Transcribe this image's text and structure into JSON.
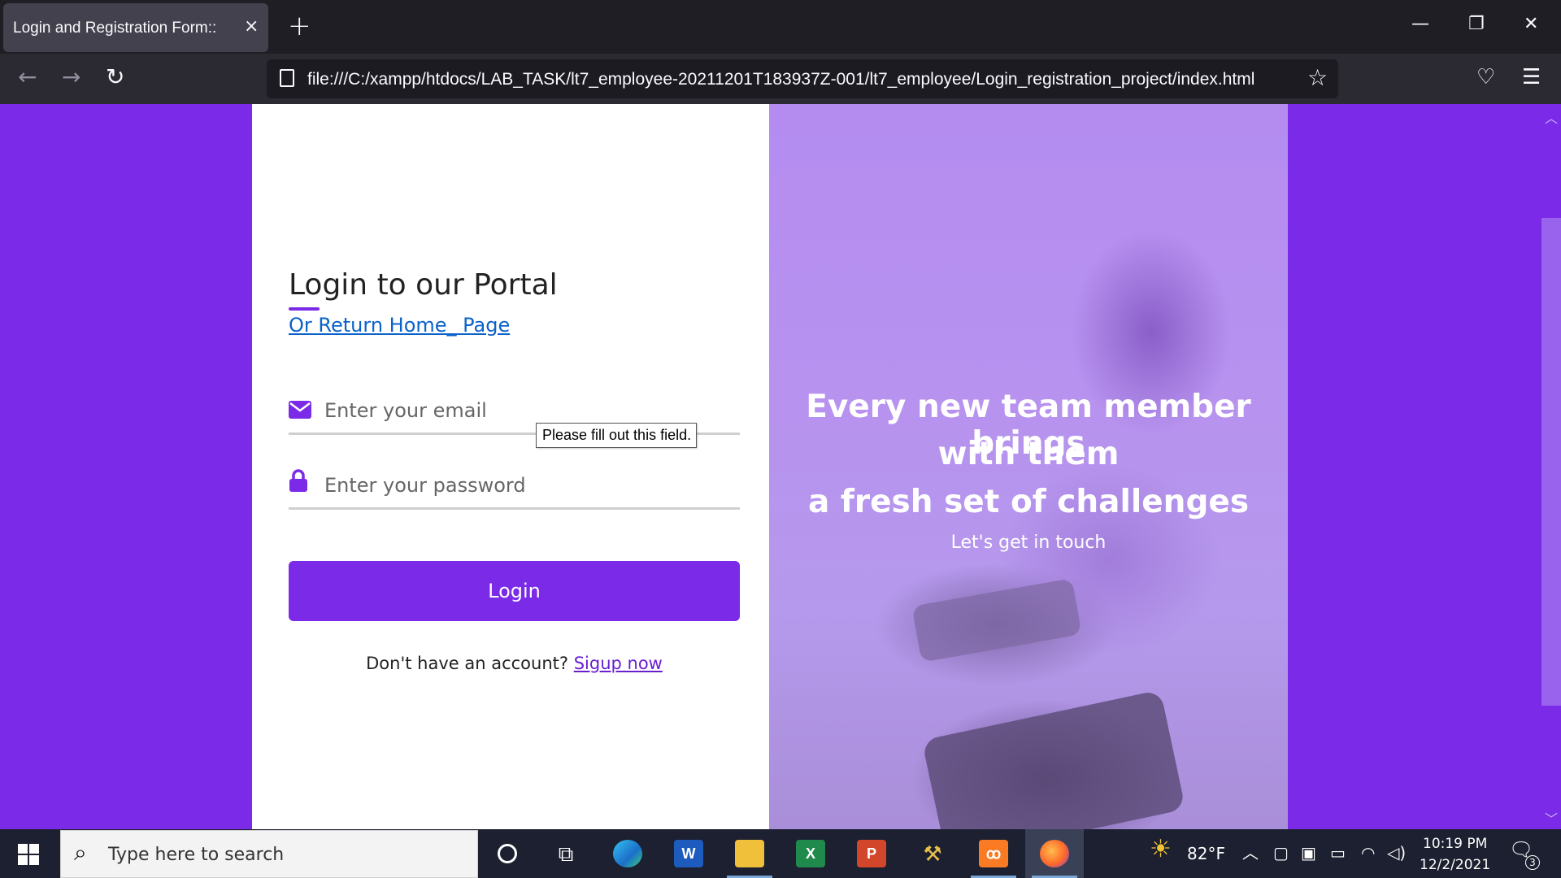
{
  "browser": {
    "tab_title": "Login and Registration Form::",
    "tab_close": "×",
    "new_tab": "+",
    "url": "file:///C:/xampp/htdocs/LAB_TASK/lt7_employee-20211201T183937Z-001/lt7_employee/Login_registration_project/index.html",
    "window_minimize": "—",
    "window_restore": "❐",
    "window_close": "✕",
    "nav_back": "←",
    "nav_forward": "→",
    "nav_reload": "↻",
    "bookmark_star": "☆",
    "pocket": "♡",
    "menu": "☰"
  },
  "login": {
    "title": "Login to our Portal",
    "home_link": "Or Return Home_ Page",
    "email_placeholder": "Enter your email",
    "password_placeholder": "Enter your password",
    "validation_tooltip": "Please fill out this field.",
    "button_label": "Login",
    "signup_prompt": "Don't have an account?",
    "signup_link": "Sigup now"
  },
  "hero": {
    "line1": "Every new team member brings",
    "line2": "with them",
    "line3": "a fresh set of challenges",
    "subtitle": "Let's get in touch"
  },
  "taskbar": {
    "search_placeholder": "Type here to search",
    "apps": [
      "cortana",
      "task-view",
      "edge",
      "word",
      "file-explorer",
      "excel",
      "powerpoint",
      "tools",
      "xampp",
      "firefox"
    ],
    "weather_temp": "82°F",
    "time": "10:19 PM",
    "date": "12/2/2021",
    "notification_count": "3"
  },
  "colors": {
    "accent": "#7b2ae8",
    "link": "#0a62c9",
    "signup_link": "#6a1fcf",
    "browser_dark": "#1f1e24",
    "taskbar": "#1c2030"
  }
}
